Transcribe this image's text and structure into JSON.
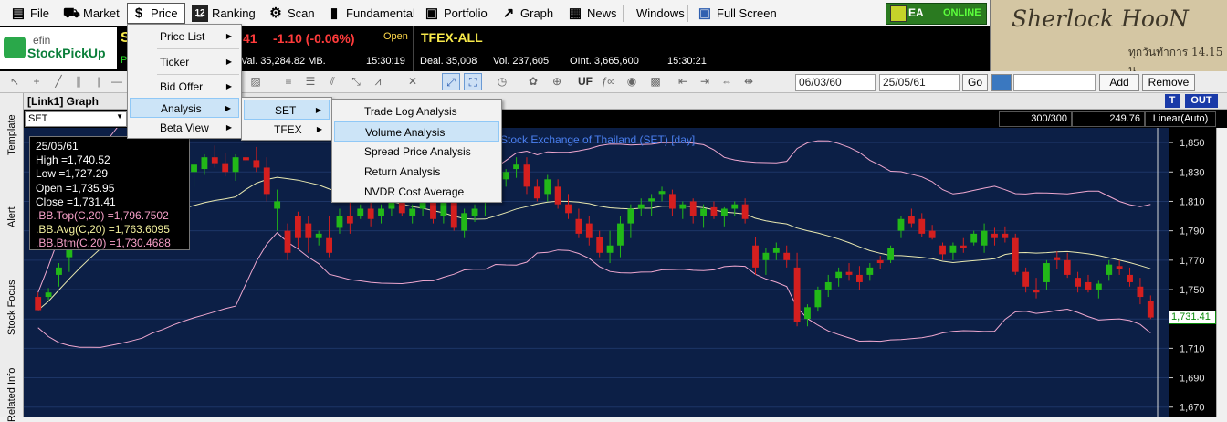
{
  "menubar": {
    "items": [
      {
        "label": "File",
        "icon": "document-icon"
      },
      {
        "label": "Market",
        "icon": "cart-icon"
      },
      {
        "label": "Price",
        "icon": "dollar-icon"
      },
      {
        "label": "Ranking",
        "icon": "ranking-icon"
      },
      {
        "label": "Scan",
        "icon": "scan-icon"
      },
      {
        "label": "Fundamental",
        "icon": "bar-chart-icon"
      },
      {
        "label": "Portfolio",
        "icon": "portfolio-icon"
      },
      {
        "label": "Graph",
        "icon": "graph-icon"
      },
      {
        "label": "News",
        "icon": "news-icon"
      },
      {
        "label": "Windows",
        "icon": ""
      },
      {
        "label": "Full Screen",
        "icon": "fullscreen-icon"
      }
    ],
    "status_ea": "EA",
    "status_online": "ONLINE"
  },
  "sherlock": {
    "title": "Sherlock HooN",
    "subtitle": "ทุกวันทำการ 14.15 น."
  },
  "logo": {
    "line1": "efin",
    "line2": "StockPickUp"
  },
  "ticker": {
    "left_change": "41",
    "change": "-1.10 (-0.06%)",
    "status": "Open",
    "value": "Val. 35,284.82 MB.",
    "time1": "15:30:19",
    "tfex_title": "TFEX-ALL",
    "deal": "Deal. 35,008",
    "vol": "Vol. 237,605",
    "oint": "OInt. 3,665,600",
    "time2": "15:30:21",
    "left_s": "S",
    "left_p": "P"
  },
  "toolbar": {
    "date_from": "06/03/60",
    "date_to": "25/05/61",
    "go": "Go",
    "add": "Add",
    "remove": "Remove",
    "uf": "UF"
  },
  "sidetabs": [
    "Template",
    "Alert",
    "Stock Focus",
    "Related Info"
  ],
  "graph": {
    "title": "[Link1] Graph",
    "symbol": "SET",
    "count": "300/300",
    "last": "249.76",
    "scale": "Linear(Auto)",
    "t_btn": "T",
    "out_btn": "OUT",
    "chart_title": "e Stock Exchange of Thailand (SET) [day]",
    "info": {
      "date": "25/05/61",
      "high": "High  =1,740.52",
      "low": "Low  =1,727.29",
      "open": "Open  =1,735.95",
      "close": "Close  =1,731.41",
      "bbtop": ".BB.Top(C,20)  =1,796.7502",
      "bbavg": ".BB.Avg(C,20)  =1,763.6095",
      "bbbtm": ".BB.Btm(C,20)  =1,730.4688"
    },
    "last_price_tag": "1,731.41"
  },
  "menus": {
    "price": [
      {
        "label": "Price List",
        "sub": true
      },
      {
        "label": "Ticker",
        "sub": true
      },
      {
        "label": "Bid Offer",
        "sub": true
      },
      {
        "label": "Analysis",
        "sub": true,
        "hl": true
      },
      {
        "label": "Beta View",
        "sub": true
      }
    ],
    "analysis": [
      {
        "label": "SET",
        "sub": true,
        "hl": true
      },
      {
        "label": "TFEX",
        "sub": true
      }
    ],
    "set": [
      {
        "label": "Trade Log Analysis"
      },
      {
        "label": "Volume Analysis",
        "hl": true
      },
      {
        "label": "Spread Price Analysis"
      },
      {
        "label": "Return Analysis"
      },
      {
        "label": "NVDR Cost Average"
      }
    ]
  },
  "chart_data": {
    "type": "candlestick",
    "title": "e Stock Exchange of Thailand (SET) [day]",
    "y_ticks": [
      1850,
      1830,
      1810,
      1790,
      1770,
      1750,
      1730,
      1710,
      1690,
      1670
    ],
    "ylim": [
      1663,
      1860
    ],
    "last": 1731.41,
    "colors": {
      "up": "#22b818",
      "down": "#d41f1f",
      "bb": "#f0a8d0",
      "avg": "#e8e8b0",
      "bg": "#0c1f46"
    },
    "candles": [
      [
        1745,
        1748,
        1740,
        1736
      ],
      [
        1745,
        1751,
        1743,
        1748
      ],
      [
        1760,
        1768,
        1752,
        1765
      ],
      [
        1772,
        1782,
        1762,
        1780
      ],
      [
        1785,
        1797,
        1782,
        1794
      ],
      [
        1800,
        1808,
        1796,
        1805
      ],
      [
        1810,
        1821,
        1806,
        1817
      ],
      [
        1817,
        1825,
        1812,
        1822
      ],
      [
        1820,
        1832,
        1818,
        1830
      ],
      [
        1828,
        1838,
        1822,
        1835
      ],
      [
        1832,
        1842,
        1828,
        1840
      ],
      [
        1840,
        1848,
        1830,
        1825
      ],
      [
        1825,
        1840,
        1820,
        1838
      ],
      [
        1838,
        1848,
        1810,
        1815
      ],
      [
        1815,
        1832,
        1812,
        1830
      ],
      [
        1830,
        1838,
        1820,
        1835
      ],
      [
        1832,
        1842,
        1828,
        1840
      ],
      [
        1840,
        1848,
        1833,
        1836
      ],
      [
        1836,
        1843,
        1827,
        1830
      ],
      [
        1830,
        1842,
        1824,
        1840
      ],
      [
        1840,
        1845,
        1836,
        1838
      ],
      [
        1838,
        1847,
        1830,
        1833
      ],
      [
        1833,
        1840,
        1810,
        1815
      ],
      [
        1805,
        1818,
        1790,
        1810
      ],
      [
        1790,
        1795,
        1770,
        1775
      ],
      [
        1800,
        1803,
        1778,
        1785
      ],
      [
        1795,
        1800,
        1775,
        1785
      ],
      [
        1785,
        1790,
        1780,
        1788
      ],
      [
        1785,
        1800,
        1772,
        1775
      ],
      [
        1792,
        1805,
        1788,
        1800
      ],
      [
        1800,
        1810,
        1788,
        1795
      ],
      [
        1800,
        1808,
        1798,
        1805
      ],
      [
        1805,
        1812,
        1793,
        1798
      ],
      [
        1800,
        1808,
        1795,
        1805
      ],
      [
        1805,
        1815,
        1800,
        1810
      ],
      [
        1810,
        1815,
        1800,
        1802
      ],
      [
        1800,
        1808,
        1795,
        1805
      ],
      [
        1805,
        1815,
        1800,
        1812
      ],
      [
        1810,
        1815,
        1795,
        1798
      ],
      [
        1800,
        1812,
        1795,
        1810
      ],
      [
        1810,
        1815,
        1790,
        1792
      ],
      [
        1790,
        1805,
        1785,
        1802
      ],
      [
        1800,
        1808,
        1796,
        1805
      ],
      [
        1810,
        1816,
        1800,
        1812
      ],
      [
        1815,
        1820,
        1810,
        1817
      ],
      [
        1825,
        1832,
        1820,
        1830
      ],
      [
        1832,
        1840,
        1826,
        1835
      ],
      [
        1835,
        1840,
        1815,
        1820
      ],
      [
        1820,
        1825,
        1810,
        1812
      ],
      [
        1815,
        1828,
        1810,
        1825
      ],
      [
        1820,
        1825,
        1805,
        1808
      ],
      [
        1808,
        1815,
        1798,
        1802
      ],
      [
        1798,
        1805,
        1785,
        1788
      ],
      [
        1795,
        1800,
        1780,
        1785
      ],
      [
        1786,
        1790,
        1772,
        1775
      ],
      [
        1775,
        1790,
        1768,
        1780
      ],
      [
        1780,
        1800,
        1772,
        1795
      ],
      [
        1795,
        1808,
        1785,
        1805
      ],
      [
        1805,
        1812,
        1800,
        1808
      ],
      [
        1810,
        1815,
        1800,
        1812
      ],
      [
        1815,
        1820,
        1810,
        1817
      ],
      [
        1815,
        1818,
        1800,
        1805
      ],
      [
        1805,
        1810,
        1798,
        1808
      ],
      [
        1810,
        1812,
        1795,
        1800
      ],
      [
        1800,
        1808,
        1792,
        1805
      ],
      [
        1806,
        1810,
        1798,
        1800
      ],
      [
        1800,
        1806,
        1793,
        1805
      ],
      [
        1805,
        1810,
        1800,
        1808
      ],
      [
        1808,
        1812,
        1795,
        1798
      ],
      [
        1780,
        1786,
        1760,
        1765
      ],
      [
        1770,
        1778,
        1760,
        1775
      ],
      [
        1775,
        1782,
        1770,
        1778
      ],
      [
        1775,
        1780,
        1765,
        1770
      ],
      [
        1765,
        1775,
        1725,
        1728
      ],
      [
        1730,
        1740,
        1725,
        1738
      ],
      [
        1738,
        1752,
        1735,
        1750
      ],
      [
        1750,
        1760,
        1745,
        1755
      ],
      [
        1758,
        1765,
        1752,
        1762
      ],
      [
        1762,
        1768,
        1756,
        1760
      ],
      [
        1760,
        1766,
        1750,
        1755
      ],
      [
        1760,
        1768,
        1756,
        1765
      ],
      [
        1770,
        1773,
        1764,
        1768
      ],
      [
        1770,
        1780,
        1768,
        1778
      ],
      [
        1790,
        1800,
        1785,
        1798
      ],
      [
        1800,
        1805,
        1792,
        1795
      ],
      [
        1798,
        1802,
        1786,
        1788
      ],
      [
        1790,
        1794,
        1784,
        1785
      ],
      [
        1780,
        1782,
        1770,
        1774
      ],
      [
        1775,
        1782,
        1770,
        1780
      ],
      [
        1780,
        1785,
        1775,
        1778
      ],
      [
        1782,
        1790,
        1780,
        1788
      ],
      [
        1780,
        1795,
        1775,
        1790
      ],
      [
        1788,
        1792,
        1780,
        1785
      ],
      [
        1788,
        1793,
        1782,
        1785
      ],
      [
        1785,
        1788,
        1760,
        1762
      ],
      [
        1762,
        1765,
        1748,
        1752
      ],
      [
        1750,
        1758,
        1744,
        1748
      ],
      [
        1755,
        1770,
        1750,
        1768
      ],
      [
        1772,
        1776,
        1764,
        1770
      ],
      [
        1770,
        1775,
        1758,
        1760
      ],
      [
        1758,
        1762,
        1748,
        1752
      ],
      [
        1755,
        1760,
        1748,
        1750
      ],
      [
        1750,
        1756,
        1744,
        1754
      ],
      [
        1760,
        1770,
        1756,
        1767
      ],
      [
        1766,
        1770,
        1760,
        1764
      ],
      [
        1760,
        1765,
        1752,
        1755
      ],
      [
        1752,
        1758,
        1740,
        1745
      ],
      [
        1742,
        1746,
        1730,
        1731
      ]
    ]
  }
}
